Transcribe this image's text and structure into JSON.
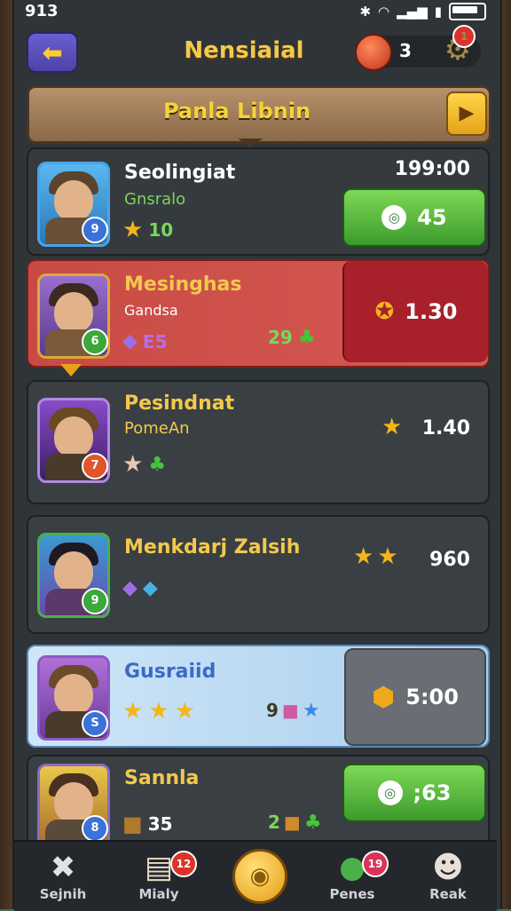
{
  "status_bar": {
    "time": "913"
  },
  "header": {
    "title": "Nensiaial",
    "coin_count": "3",
    "notification_count": "1"
  },
  "banner": {
    "title": "Panla Libnin",
    "button_icon": "play-arrow-icon"
  },
  "rows": [
    {
      "name": "Seolingiat",
      "subtitle": "Gnsralo",
      "stat": "10",
      "right_value": "199:00",
      "button_value": "45",
      "level": "9",
      "colors": {
        "name": "#ffffff",
        "subtitle": "#7bd65a",
        "stat": "#7bd65a"
      }
    },
    {
      "name": "Mesinghas",
      "subtitle": "Gandsa",
      "stat": "E5",
      "right_badge": "29",
      "right_value": "1.30",
      "level": "6",
      "colors": {
        "name": "#f2c94c",
        "subtitle": "#ffffff",
        "stat": "#b46ee8"
      }
    },
    {
      "name": "Pesindnat",
      "subtitle": "PomeAn",
      "right_value": "1.40",
      "level": "7",
      "colors": {
        "name": "#f2c94c",
        "subtitle": "#f2c94c"
      }
    },
    {
      "name": "Menkdarj Zalsih",
      "right_value": "960",
      "level": "9",
      "colors": {
        "name": "#f2c94c"
      }
    },
    {
      "name": "Gusraiid",
      "right_badge": "9",
      "right_value": "5:00",
      "level": "S",
      "colors": {
        "name": "#3a6ac8"
      }
    },
    {
      "name": "Sannla",
      "stat": "35",
      "right_badge": "2",
      "button_value": ";63",
      "level": "8",
      "colors": {
        "name": "#f2c94c",
        "stat": "#ffffff"
      }
    }
  ],
  "nav": [
    {
      "label": "Sejnih",
      "icon": "close-x-icon"
    },
    {
      "label": "Mialy",
      "icon": "inbox-icon",
      "badge": "12"
    },
    {
      "label": "",
      "icon": "gold-coin-icon"
    },
    {
      "label": "Penes",
      "icon": "chat-bubble-icon",
      "badge": "19"
    },
    {
      "label": "Reak",
      "icon": "character-icon"
    }
  ]
}
